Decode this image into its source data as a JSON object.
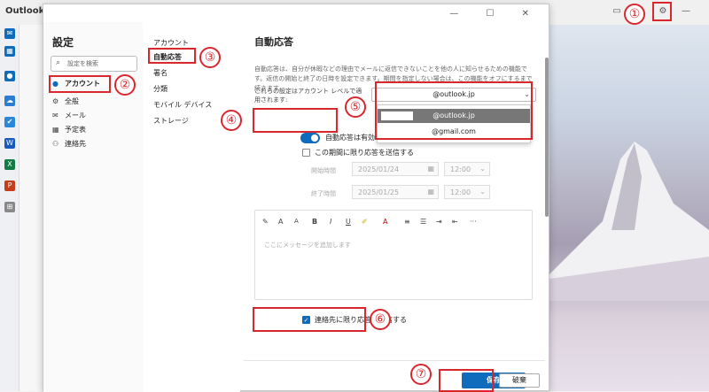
{
  "app": {
    "title": "Outlook"
  },
  "dialog": {
    "controls": "— ☐ ✕"
  },
  "nav1": {
    "title": "設定",
    "search_placeholder": "設定を検索",
    "items": [
      {
        "label": "アカウント",
        "icon": "person-icon"
      },
      {
        "label": "全般",
        "icon": "gear-icon"
      },
      {
        "label": "メール",
        "icon": "mail-icon"
      },
      {
        "label": "予定表",
        "icon": "calendar-icon"
      },
      {
        "label": "連絡先",
        "icon": "people-icon"
      }
    ]
  },
  "nav2": {
    "items": [
      "アカウント",
      "自動応答",
      "署名",
      "分類",
      "モバイル デバイス",
      "ストレージ"
    ]
  },
  "content": {
    "title": "自動応答",
    "description": "自動応答は、自分が休暇などの理由でメールに返信できないことを他の人に知らせるための機能です。返信の開始と終了の日時を設定できます。期間を指定しない場合は、この機能をオフにするまで続きます。",
    "scope_label": "これらの設定はアカウント レベルで適用されます:",
    "account_dropdown": "@outlook.jp",
    "dropdown_options": [
      "@outlook.jp",
      "@gmail.com"
    ],
    "toggle_label": "自動応答は有効",
    "period_label": "この期間に限り応答を送信する",
    "start_label": "開始時間",
    "start_date": "2025/01/24",
    "start_time": "12:00",
    "end_label": "終了時間",
    "end_date": "2025/01/25",
    "end_time": "12:00",
    "toolbar": [
      "✎",
      "A",
      "A",
      "B",
      "I",
      "U",
      "✐",
      "A",
      "≡",
      "☰",
      "⇥",
      "⇤",
      "···"
    ],
    "placeholder": "ここにメッセージを追加します",
    "contacts_only_label": "連絡先に限り応答を送信する",
    "save_label": "保存",
    "discard_label": "破棄"
  },
  "markers": [
    "①",
    "②",
    "③",
    "④",
    "⑤",
    "⑥",
    "⑦"
  ],
  "colors": {
    "accent": "#0f6cbd",
    "annotation": "#d9272e"
  }
}
